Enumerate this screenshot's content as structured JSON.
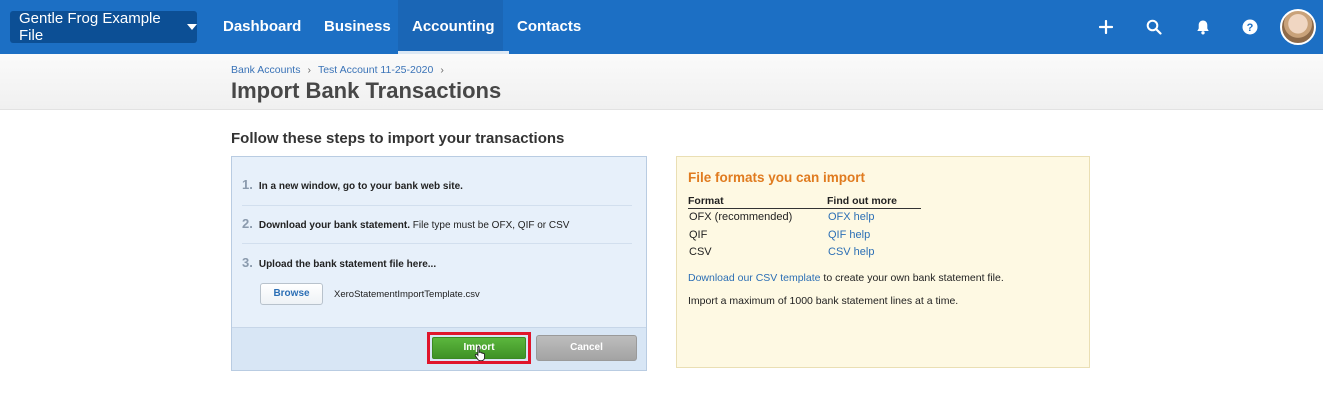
{
  "nav": {
    "org_name": "Gentle Frog Example File",
    "tabs": [
      "Dashboard",
      "Business",
      "Accounting",
      "Contacts"
    ],
    "active_tab": "Accounting",
    "icons": [
      "plus-icon",
      "search-icon",
      "bell-icon",
      "help-icon",
      "avatar"
    ]
  },
  "breadcrumb": {
    "items": [
      "Bank Accounts",
      "Test Account 11-25-2020"
    ],
    "separator": "›"
  },
  "page": {
    "title": "Import Bank Transactions",
    "steps_heading": "Follow these steps to import your transactions"
  },
  "steps": {
    "step1": {
      "num": "1.",
      "bold": "In a new window, go to your bank web site.",
      "rest": ""
    },
    "step2": {
      "num": "2.",
      "bold": "Download your bank statement.",
      "rest": " File type must be OFX, QIF or CSV"
    },
    "step3": {
      "num": "3.",
      "bold": "Upload the bank statement file here...",
      "rest": ""
    },
    "browse_label": "Browse",
    "file_name": "XeroStatementImportTemplate.csv",
    "import_label": "Import",
    "cancel_label": "Cancel"
  },
  "formats": {
    "title": "File formats you can import",
    "col_format": "Format",
    "col_find": "Find out more",
    "rows": [
      {
        "format": "OFX (recommended)",
        "link": "OFX help"
      },
      {
        "format": "QIF",
        "link": "QIF help"
      },
      {
        "format": "CSV",
        "link": "CSV help"
      }
    ],
    "csv_template_link": "Download our CSV template",
    "csv_template_rest": " to create your own bank statement file.",
    "max_lines_text": "Import a maximum of 1000 bank statement lines at a time."
  },
  "colors": {
    "nav_bg": "#1c6fc4",
    "accent_orange": "#e07b1f",
    "import_green": "#4ca32f",
    "highlight_red": "#e0152b",
    "link_blue": "#2c6fb5"
  }
}
